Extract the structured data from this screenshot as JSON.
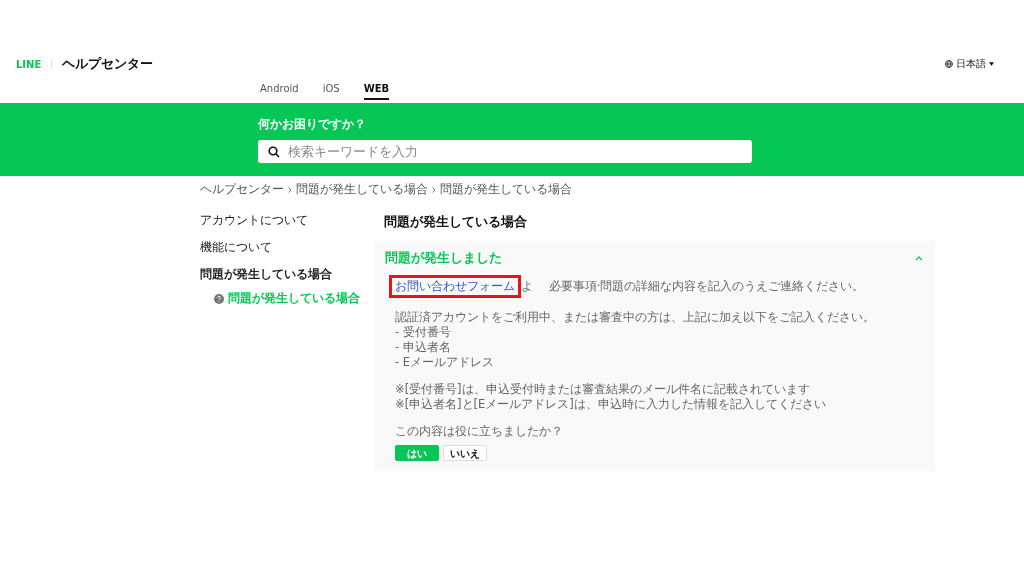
{
  "header": {
    "logo": "LINE",
    "title": "ヘルプセンター",
    "language": "日本語"
  },
  "tabs": [
    {
      "label": "Android",
      "selected": false
    },
    {
      "label": "iOS",
      "selected": false
    },
    {
      "label": "WEB",
      "selected": true
    }
  ],
  "banner": {
    "heading": "何かお困りですか？",
    "search": {
      "placeholder": "検索キーワードを入力"
    }
  },
  "breadcrumb": [
    "ヘルプセンター",
    "問題が発生している場合",
    "問題が発生している場合"
  ],
  "sidebar": {
    "items": [
      {
        "label": "アカウントについて",
        "selected": false
      },
      {
        "label": "機能について",
        "selected": false
      },
      {
        "label": "問題が発生している場合",
        "selected": true,
        "children": [
          {
            "label": "問題が発生している場合",
            "selected": true
          }
        ]
      }
    ]
  },
  "article": {
    "title": "問題が発生している場合",
    "section": {
      "title": "問題が発生しました",
      "expanded": true,
      "link": "お問い合わせフォーム",
      "link_highlighted": true,
      "link_tail": "よ",
      "lead_rest": "必要事項·問題の詳細な内容を記入のうえご連絡ください。",
      "paragraphs": [
        [
          "認証済アカウントをご利用中、または審査中の方は、上記に加え以下をご記入ください。",
          "- 受付番号",
          "- 申込者名",
          "- Eメールアドレス"
        ],
        [
          "※[受付番号]は、申込受付時または審査結果のメール件名に記載されています",
          "※[申込者名]と[Eメールアドレス]は、申込時に入力した情報を記入してください"
        ]
      ],
      "feedback": {
        "question": "この内容は役に立ちましたか？",
        "buttons": [
          {
            "label": "はい",
            "selected": true
          },
          {
            "label": "いいえ",
            "selected": false
          }
        ]
      }
    }
  }
}
